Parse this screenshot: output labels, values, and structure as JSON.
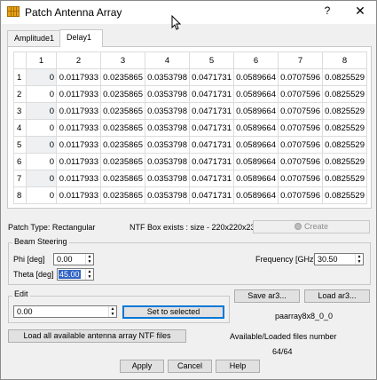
{
  "window": {
    "title": "Patch Antenna Array",
    "help": "?",
    "close": "✕"
  },
  "tabs": [
    {
      "label": "Amplitude1"
    },
    {
      "label": "Delay1"
    }
  ],
  "grid": {
    "columns": [
      "1",
      "2",
      "3",
      "4",
      "5",
      "6",
      "7",
      "8"
    ],
    "rows": [
      {
        "header": "1",
        "cells": [
          "0",
          "0.0117933",
          "0.0235865",
          "0.0353798",
          "0.0471731",
          "0.0589664",
          "0.0707596",
          "0.0825529"
        ]
      },
      {
        "header": "2",
        "cells": [
          "0",
          "0.0117933",
          "0.0235865",
          "0.0353798",
          "0.0471731",
          "0.0589664",
          "0.0707596",
          "0.0825529"
        ]
      },
      {
        "header": "3",
        "cells": [
          "0",
          "0.0117933",
          "0.0235865",
          "0.0353798",
          "0.0471731",
          "0.0589664",
          "0.0707596",
          "0.0825529"
        ]
      },
      {
        "header": "4",
        "cells": [
          "0",
          "0.0117933",
          "0.0235865",
          "0.0353798",
          "0.0471731",
          "0.0589664",
          "0.0707596",
          "0.0825529"
        ]
      },
      {
        "header": "5",
        "cells": [
          "0",
          "0.0117933",
          "0.0235865",
          "0.0353798",
          "0.0471731",
          "0.0589664",
          "0.0707596",
          "0.0825529"
        ]
      },
      {
        "header": "6",
        "cells": [
          "0",
          "0.0117933",
          "0.0235865",
          "0.0353798",
          "0.0471731",
          "0.0589664",
          "0.0707596",
          "0.0825529"
        ]
      },
      {
        "header": "7",
        "cells": [
          "0",
          "0.0117933",
          "0.0235865",
          "0.0353798",
          "0.0471731",
          "0.0589664",
          "0.0707596",
          "0.0825529"
        ]
      },
      {
        "header": "8",
        "cells": [
          "0",
          "0.0117933",
          "0.0235865",
          "0.0353798",
          "0.0471731",
          "0.0589664",
          "0.0707596",
          "0.0825529"
        ]
      }
    ]
  },
  "info": {
    "patch_type": "Patch Type: Rectangular",
    "ntf_box": "NTF Box exists : size - 220x220x23",
    "create_label": "Create"
  },
  "beam_steering": {
    "title": "Beam Steering",
    "phi_label": "Phi [deg]",
    "phi_value": "0.00",
    "theta_label": "Theta [deg]",
    "theta_value": "45.00",
    "frequency_label": "Frequency [GHz]",
    "frequency_value": "30.50"
  },
  "edit": {
    "title": "Edit",
    "value": "0.00",
    "set_label": "Set to selected"
  },
  "files": {
    "save_label": "Save ar3...",
    "load_label": "Load ar3...",
    "file_name": "paarray8x8_0_0",
    "load_all_label": "Load all available antenna array NTF files",
    "status_label": "Available/Loaded files number",
    "status_value": "64/64"
  },
  "footer": {
    "apply": "Apply",
    "cancel": "Cancel",
    "help": "Help"
  }
}
